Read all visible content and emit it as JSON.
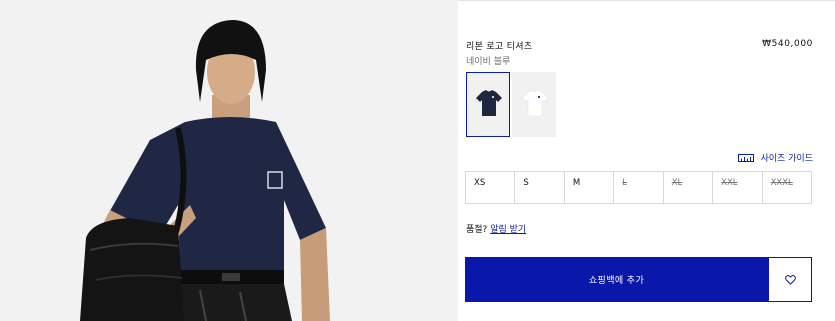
{
  "product": {
    "title": "리본 로고 티셔츠",
    "price": "₩540,000",
    "color_name": "네이비 블루"
  },
  "swatches": [
    {
      "name": "navy",
      "color": "#1e2640",
      "selected": true
    },
    {
      "name": "white",
      "color": "#e9ecf0",
      "selected": false
    }
  ],
  "size_guide": {
    "label": "사이즈 가이드",
    "icon": "ruler-icon"
  },
  "sizes": [
    {
      "label": "XS",
      "available": true
    },
    {
      "label": "S",
      "available": true
    },
    {
      "label": "M",
      "available": true
    },
    {
      "label": "L",
      "available": false
    },
    {
      "label": "XL",
      "available": false
    },
    {
      "label": "XXL",
      "available": false
    },
    {
      "label": "XXXL",
      "available": false
    }
  ],
  "out_of_stock": {
    "prefix": "품절?",
    "link": "알림 받기"
  },
  "actions": {
    "add_to_cart": "쇼핑백에 추가",
    "wishlist_icon": "heart-icon"
  },
  "colors": {
    "accent": "#0a17ab",
    "border": "#d8d8d8"
  }
}
